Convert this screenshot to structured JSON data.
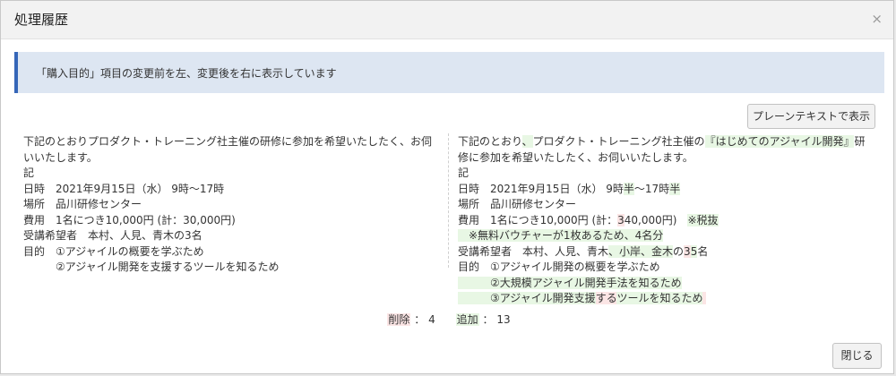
{
  "dialog": {
    "title": "処理履歴",
    "close_icon": "×"
  },
  "notice": "「購入目的」項目の変更前を左、変更後を右に表示しています",
  "plain_text_button": "プレーンテキストで表示",
  "left_lines": [
    "下記のとおりプロダクト・トレーニング社主催の研修に参加を希望いたしたく、お伺",
    "いいたします。",
    "記",
    "日時　2021年9月15日（水） 9時～17時",
    "場所　品川研修センター",
    "費用　1名につき10,000円 (計：30,000円)",
    "受講希望者　本村、人見、青木の3名",
    "目的　①アジャイルの概要を学ぶため",
    "　　　②アジャイル開発を支援するツールを知るため"
  ],
  "right_lines": [
    [
      {
        "t": "下記のとおり"
      },
      {
        "t": "、",
        "c": "ins"
      },
      {
        "t": "プロダクト・トレーニング社主催の"
      },
      {
        "t": "『はじめてのアジャイル開発』",
        "c": "ins"
      },
      {
        "t": "研"
      }
    ],
    [
      {
        "t": "修に参加を希望いたしたく、お伺いいたします。"
      }
    ],
    [
      {
        "t": "記"
      }
    ],
    [
      {
        "t": "日時　2021年9月15日（水） 9時"
      },
      {
        "t": "半",
        "c": "ins"
      },
      {
        "t": "～17時"
      },
      {
        "t": "半",
        "c": "ins"
      }
    ],
    [
      {
        "t": "場所　品川研修センター"
      }
    ],
    [
      {
        "t": "費用　1名につき10,000円 (計："
      },
      {
        "t": "3",
        "c": "del"
      },
      {
        "t": "40,000円)　"
      },
      {
        "t": "※税抜",
        "c": "ins"
      }
    ],
    [
      {
        "t": "　※無料バウチャーが1枚あるため、4名分",
        "c": "ins"
      }
    ],
    [
      {
        "t": "受講希望者　本村、人見、青木"
      },
      {
        "t": "、小岸、金木",
        "c": "ins"
      },
      {
        "t": "の"
      },
      {
        "t": "3",
        "c": "del"
      },
      {
        "t": "5",
        "c": "ins"
      },
      {
        "t": "名"
      }
    ],
    [
      {
        "t": "目的　①アジャイル開発の概要を学ぶため"
      }
    ],
    [
      {
        "t": "　　　②大規模アジャイル開発手法を知るため",
        "c": "ins"
      }
    ],
    [
      {
        "t": "　　　③アジャイル開発支援",
        "c": "ins"
      },
      {
        "t": "する",
        "c": "del"
      },
      {
        "t": "ツールを知るため",
        "c": "ins"
      },
      {
        "t": " ",
        "c": "del"
      }
    ]
  ],
  "summary": {
    "deleted_label": "削除",
    "deleted_count": "4",
    "added_label": "追加",
    "added_count": "13",
    "sep": "："
  },
  "close_button": "閉じる",
  "colors": {
    "insert_bg": "#e8f7e4",
    "delete_bg": "#fbe5e5",
    "notice_bg": "#dde6f2",
    "notice_border": "#3566b8"
  }
}
